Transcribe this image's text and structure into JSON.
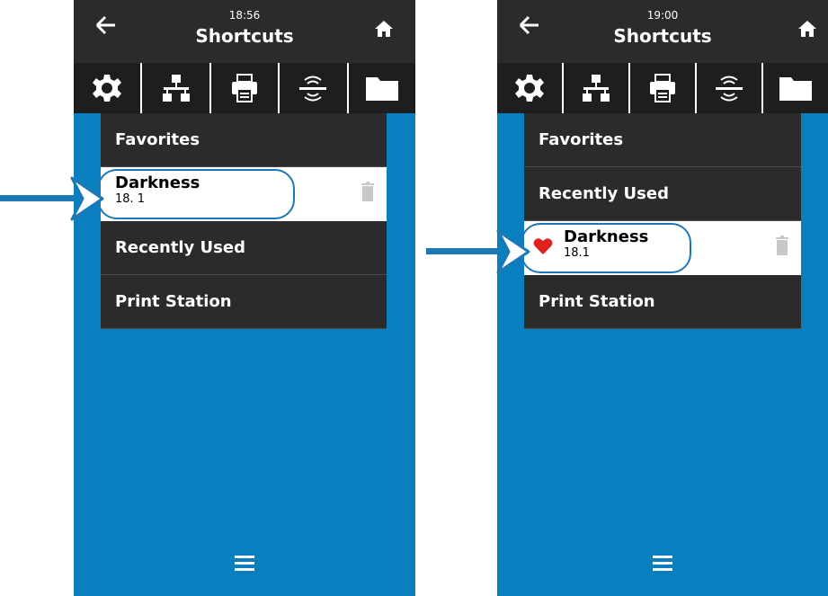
{
  "screens": [
    {
      "time": "18:56",
      "title": "Shortcuts",
      "menu": [
        {
          "type": "section",
          "label": "Favorites"
        },
        {
          "type": "item",
          "name": "Darkness",
          "value": "18. 1",
          "favorite": false
        },
        {
          "type": "section",
          "label": "Recently Used"
        },
        {
          "type": "section",
          "label": "Print Station"
        }
      ]
    },
    {
      "time": "19:00",
      "title": "Shortcuts",
      "menu": [
        {
          "type": "section",
          "label": "Favorites"
        },
        {
          "type": "section",
          "label": "Recently Used"
        },
        {
          "type": "item",
          "name": "Darkness",
          "value": "18.1",
          "favorite": true
        },
        {
          "type": "section",
          "label": "Print Station"
        }
      ]
    }
  ],
  "icons": {
    "back": "back-arrow-icon",
    "home": "home-icon",
    "tabs": [
      "settings-gear-icon",
      "network-icon",
      "printer-icon",
      "sensor-icon",
      "folder-icon"
    ],
    "heart": "heart-icon",
    "trash": "trash-icon",
    "hamburger": "hamburger-menu-icon"
  },
  "colors": {
    "screen_background": "#0a7fbf",
    "header_background": "#2b2b2b",
    "callout_blue": "#1c78b5",
    "heart_red": "#e0211d"
  }
}
